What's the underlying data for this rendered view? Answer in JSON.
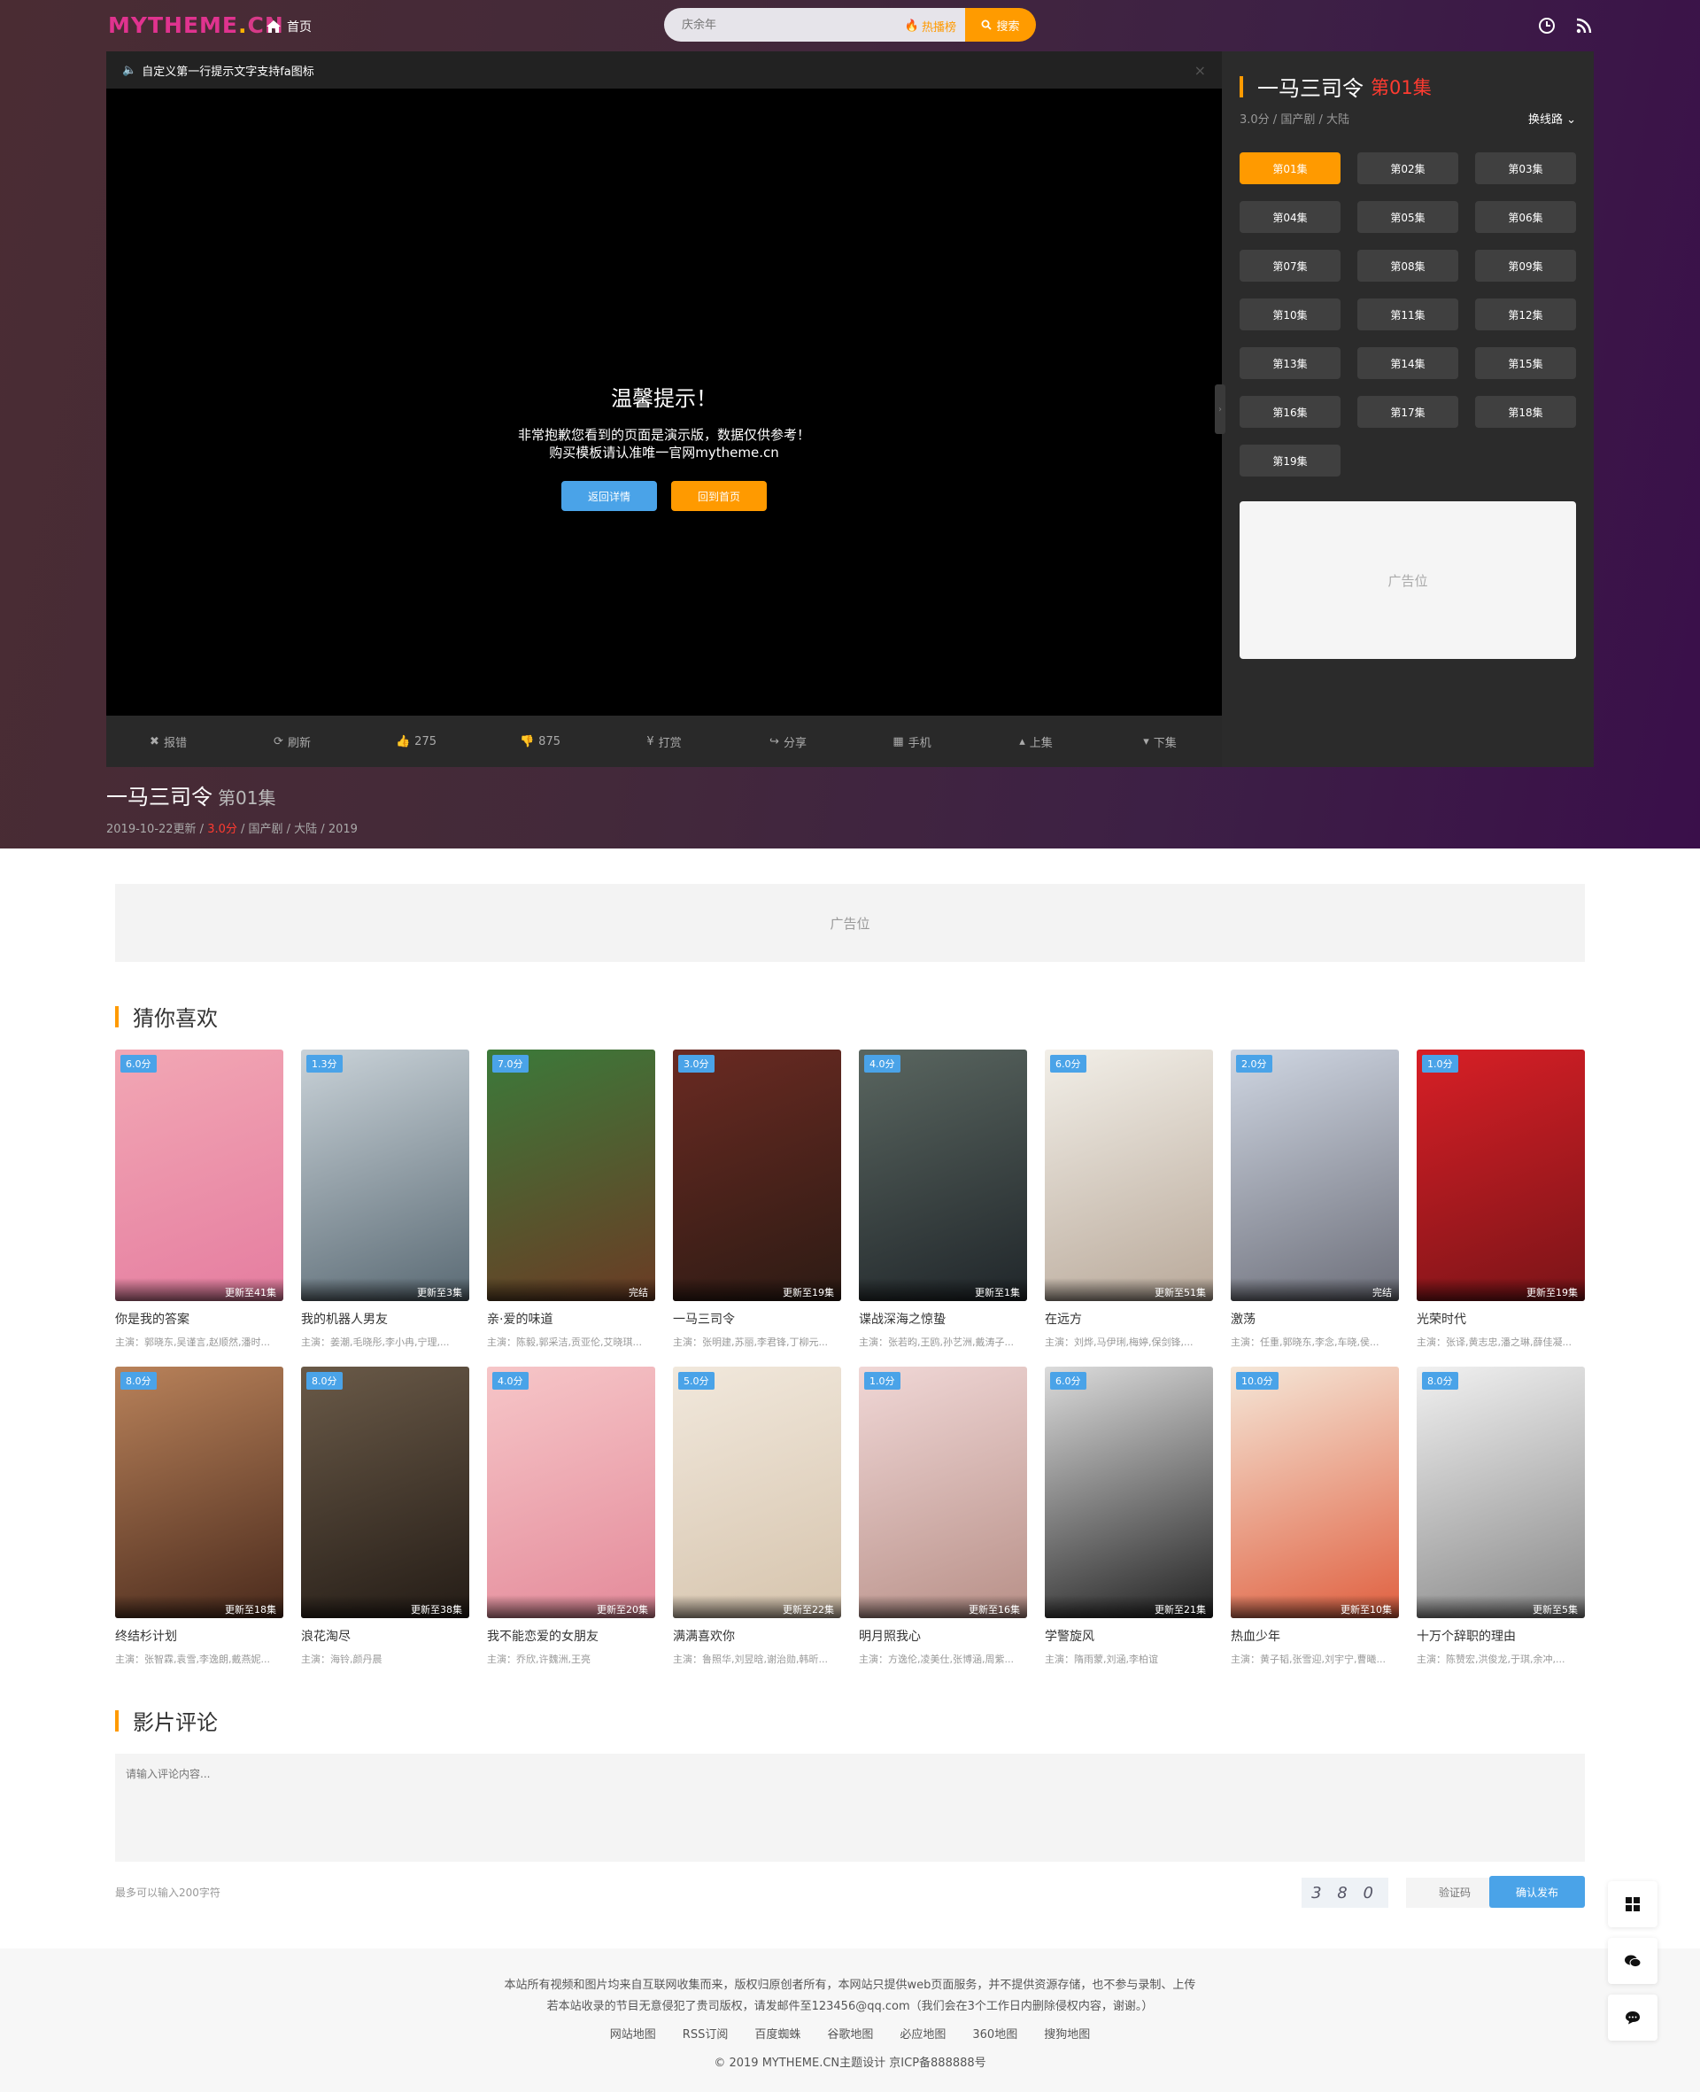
{
  "header": {
    "logo_main": "MYTHEME",
    "logo_dot": ".",
    "logo_cn": "CN",
    "home": "首页",
    "search_placeholder": "庆余年",
    "hot": "热播榜",
    "search_btn": "搜索"
  },
  "player": {
    "notice": "自定义第一行提示文字支持fa图标",
    "close": "×",
    "tip_title": "温馨提示！",
    "tip_line1": "非常抱歉您看到的页面是演示版，数据仅供参考！",
    "tip_line2": "购买模板请认准唯一官网mytheme.cn",
    "btn_back": "返回详情",
    "btn_home": "回到首页",
    "controls": [
      {
        "label": "报错",
        "icon": "close-icon",
        "glyph": "✖"
      },
      {
        "label": "刷新",
        "icon": "refresh-icon",
        "glyph": "⟳"
      },
      {
        "label": "275",
        "icon": "thumbs-up-icon",
        "glyph": "👍"
      },
      {
        "label": "875",
        "icon": "thumbs-down-icon",
        "glyph": "👎"
      },
      {
        "label": "打赏",
        "icon": "yen-icon",
        "glyph": "¥"
      },
      {
        "label": "分享",
        "icon": "share-icon",
        "glyph": "↪"
      },
      {
        "label": "手机",
        "icon": "qrcode-icon",
        "glyph": "▦"
      },
      {
        "label": "上集",
        "icon": "caret-up-icon",
        "glyph": "▴"
      },
      {
        "label": "下集",
        "icon": "caret-down-icon",
        "glyph": "▾"
      }
    ]
  },
  "sidebar": {
    "title": "一马三司令",
    "episode": "第01集",
    "meta": "3.0分 / 国产剧 / 大陆",
    "switch_line": "换线路",
    "episodes": [
      "第01集",
      "第02集",
      "第03集",
      "第04集",
      "第05集",
      "第06集",
      "第07集",
      "第08集",
      "第09集",
      "第10集",
      "第11集",
      "第12集",
      "第13集",
      "第14集",
      "第15集",
      "第16集",
      "第17集",
      "第18集",
      "第19集"
    ],
    "ad": "广告位"
  },
  "info": {
    "title": "一马三司令",
    "episode": "第01集",
    "date": "2019-10-22更新 / ",
    "score": "3.0分",
    "rest": " / 国产剧 / 大陆 / 2019"
  },
  "ad_wide": "广告位",
  "recommend": {
    "heading": "猜你喜欢",
    "items": [
      {
        "title": "你是我的答案",
        "cast": "主演：郭晓东,吴谨言,赵顺然,潘时...",
        "score": "6.0分",
        "update": "更新至41集",
        "color1": "#f2a7b4",
        "color2": "#e57da0"
      },
      {
        "title": "我的机器人男友",
        "cast": "主演：姜潮,毛晓彤,李小冉,宁理,...",
        "score": "1.3分",
        "update": "更新至3集",
        "color1": "#c9d2d8",
        "color2": "#5a6a74"
      },
      {
        "title": "亲·爱的味道",
        "cast": "主演：陈毅,郭采洁,贡亚伦,艾晓琪...",
        "score": "7.0分",
        "update": "完结",
        "color1": "#3b7a3a",
        "color2": "#6b3b24"
      },
      {
        "title": "一马三司令",
        "cast": "主演：张明建,苏丽,李君锋,丁柳元...",
        "score": "3.0分",
        "update": "更新至19集",
        "color1": "#6a2a22",
        "color2": "#2d1b14"
      },
      {
        "title": "谍战深海之惊蛰",
        "cast": "主演：张若昀,王鸥,孙艺洲,戴涛子...",
        "score": "4.0分",
        "update": "更新至1集",
        "color1": "#5a6660",
        "color2": "#20262a"
      },
      {
        "title": "在远方",
        "cast": "主演：刘烨,马伊琍,梅婷,保剑锋,...",
        "score": "6.0分",
        "update": "更新至51集",
        "color1": "#f2efe8",
        "color2": "#b9a99a"
      },
      {
        "title": "激荡",
        "cast": "主演：任重,郭晓东,李念,车晓,侯...",
        "score": "2.0分",
        "update": "完结",
        "color1": "#cfd6e2",
        "color2": "#6d6f7a"
      },
      {
        "title": "光荣时代",
        "cast": "主演：张译,黄志忠,潘之琳,薛佳凝...",
        "score": "1.0分",
        "update": "更新至19集",
        "color1": "#d81f26",
        "color2": "#7a1418"
      },
      {
        "title": "终结杉计划",
        "cast": "主演：张智霖,袁雪,李逸朗,戴燕妮...",
        "score": "8.0分",
        "update": "更新至18集",
        "color1": "#b9825a",
        "color2": "#4a2a1c"
      },
      {
        "title": "浪花淘尽",
        "cast": "主演：海铃,颜丹晨",
        "score": "8.0分",
        "update": "更新至38集",
        "color1": "#6a5a48",
        "color2": "#241c16"
      },
      {
        "title": "我不能恋爱的女朋友",
        "cast": "主演：乔欣,许魏洲,王亮",
        "score": "4.0分",
        "update": "更新至20集",
        "color1": "#f6c6c8",
        "color2": "#e48a9a"
      },
      {
        "title": "满满喜欢你",
        "cast": "主演：鲁照华,刘昱晗,谢治勋,韩昕...",
        "score": "5.0分",
        "update": "更新至22集",
        "color1": "#f1e8dc",
        "color2": "#d6c4ad"
      },
      {
        "title": "明月照我心",
        "cast": "主演：方逸伦,凌美仕,张博涵,周紫...",
        "score": "1.0分",
        "update": "更新至16集",
        "color1": "#f0d7d6",
        "color2": "#b89088"
      },
      {
        "title": "学警旋风",
        "cast": "主演：隋雨蒙,刘涵,李柏谊",
        "score": "6.0分",
        "update": "更新至21集",
        "color1": "#dcdcdc",
        "color2": "#222222"
      },
      {
        "title": "热血少年",
        "cast": "主演：黄子韬,张雪迎,刘宇宁,曹曦...",
        "score": "10.0分",
        "update": "更新至10集",
        "color1": "#f5e7d8",
        "color2": "#e06040"
      },
      {
        "title": "十万个辞职的理由",
        "cast": "主演：陈赞宏,洪俊龙,于琪,余冲,...",
        "score": "8.0分",
        "update": "更新至5集",
        "color1": "#f1f1f1",
        "color2": "#888888"
      }
    ]
  },
  "comment": {
    "heading": "影片评论",
    "placeholder": "请输入评论内容...",
    "limit": "最多可以输入200字符",
    "captcha": "3 8 0",
    "captcha_placeholder": "验证码",
    "submit": "确认发布"
  },
  "footer": {
    "line1": "本站所有视频和图片均来自互联网收集而来，版权归原创者所有，本网站只提供web页面服务，并不提供资源存储，也不参与录制、上传",
    "line2": "若本站收录的节目无意侵犯了贵司版权，请发邮件至123456@qq.com（我们会在3个工作日内删除侵权内容，谢谢。）",
    "links": [
      "网站地图",
      "RSS订阅",
      "百度蜘蛛",
      "谷歌地图",
      "必应地图",
      "360地图",
      "搜狗地图"
    ],
    "copyright": "© 2019 MYTHEME.CN主题设计 京ICP备888888号"
  }
}
